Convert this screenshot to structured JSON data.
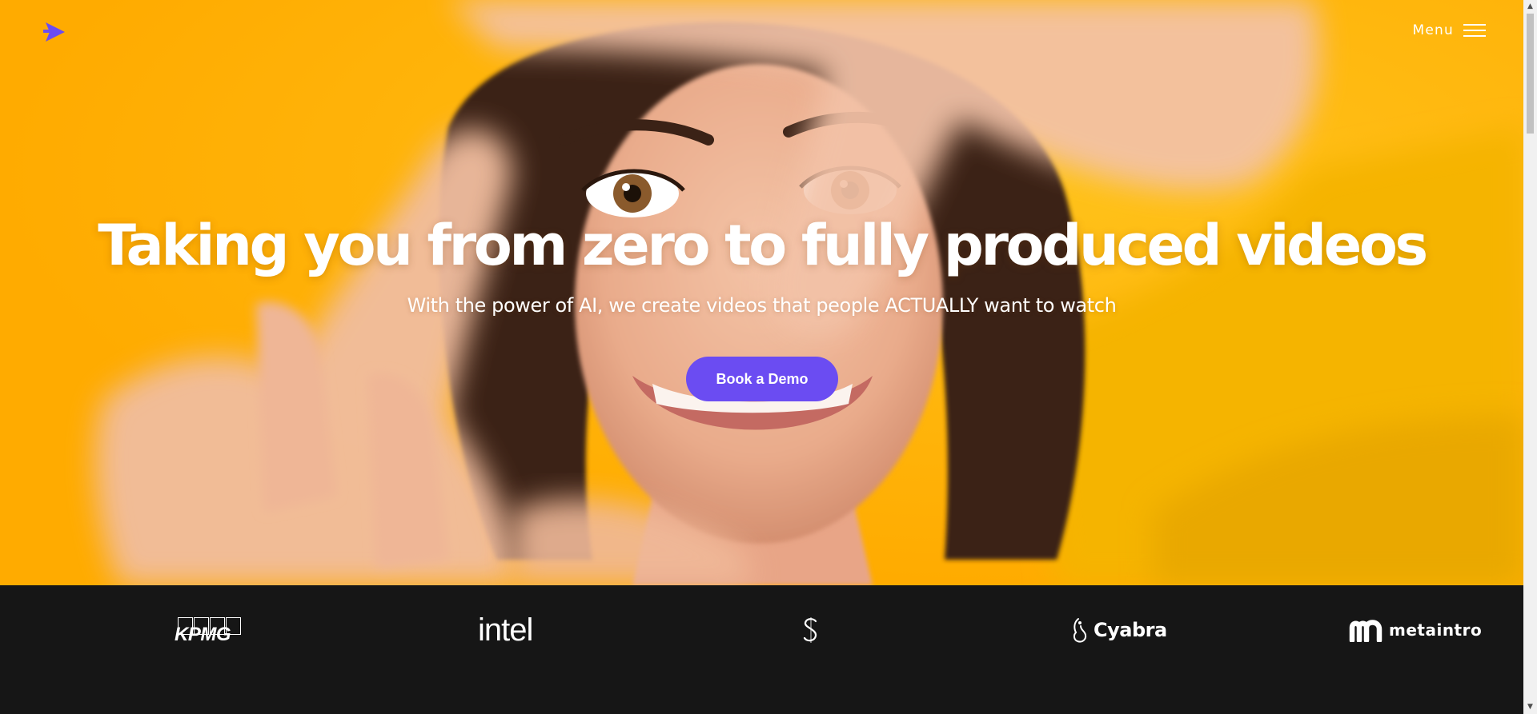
{
  "header": {
    "logo_icon": "play-arrow-logo-icon",
    "menu_label": "Menu",
    "menu_icon": "hamburger-icon"
  },
  "hero": {
    "headline": "Taking you from zero to fully produced videos",
    "subheadline": "With the power of AI, we create videos that people ACTUALLY want to watch",
    "cta_label": "Book a Demo",
    "background_color": "#ffb100",
    "cta_color": "#6b4cf2"
  },
  "clients": {
    "background_color": "#161616",
    "logos": [
      {
        "name": "KPMG",
        "text": "KPMG"
      },
      {
        "name": "Intel",
        "text": "intel"
      },
      {
        "name": "S logo",
        "text": "S"
      },
      {
        "name": "Cyabra",
        "text": "Cyabra"
      },
      {
        "name": "metaintro",
        "text": "metaintro"
      }
    ]
  },
  "brand": {
    "accent": "#6b4cf2",
    "white": "#ffffff"
  }
}
